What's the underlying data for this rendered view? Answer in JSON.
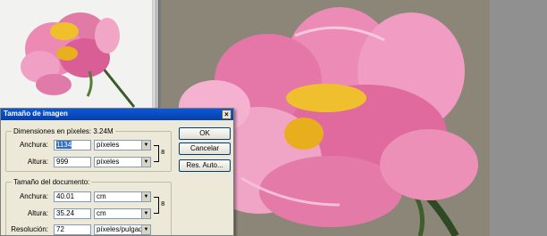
{
  "dialog": {
    "title": "Tamaño de imagen",
    "close_glyph": "×",
    "buttons": {
      "ok": "OK",
      "cancel": "Cancelar",
      "auto": "Res. Auto..."
    },
    "pixel_dimensions": {
      "legend": "Dimensiones en píxeles: 3.24M",
      "width_label": "Anchura:",
      "width_value": "1134",
      "width_unit": "píxeles",
      "height_label": "Altura:",
      "height_value": "999",
      "height_unit": "píxeles"
    },
    "document_size": {
      "legend": "Tamaño del documento:",
      "width_label": "Anchura:",
      "width_value": "40.01",
      "width_unit": "cm",
      "height_label": "Altura:",
      "height_value": "35.24",
      "height_unit": "cm",
      "resolution_label": "Resolución:",
      "resolution_value": "72",
      "resolution_unit": "píxeles/pulgada"
    }
  },
  "icons": {
    "link": "chain-link-icon",
    "dropdown": "chevron-down-icon"
  },
  "colors": {
    "titlebar": "#0a58d8",
    "dialog_bg": "#ece9d8",
    "petal": "#e86aa0",
    "stamen": "#e8b020"
  }
}
